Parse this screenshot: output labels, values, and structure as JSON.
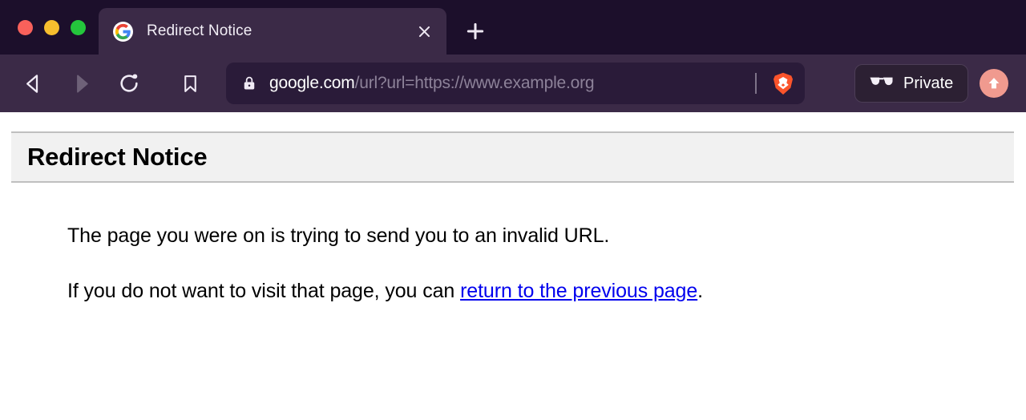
{
  "browser": {
    "name": "brave-browser",
    "window_controls": [
      {
        "name": "close",
        "color": "#F9615B"
      },
      {
        "name": "minimize",
        "color": "#F7BE2E"
      },
      {
        "name": "maximize",
        "color": "#24C63C"
      }
    ],
    "tab": {
      "title": "Redirect Notice",
      "favicon": "google-g-icon",
      "close_label": "×"
    },
    "new_tab_label": "+",
    "nav": {
      "back_label": "Back",
      "forward_label": "Forward",
      "reload_label": "Reload",
      "bookmark_label": "Bookmark"
    },
    "urlbar": {
      "lock": "secure-lock-icon",
      "host": "google.com",
      "path": "/url?url=https://www.example.org",
      "full_url": "google.com/url?url=https://www.example.org",
      "shields": "brave-lion-icon"
    },
    "private_button": {
      "label": "Private",
      "icon": "sunglasses-icon"
    },
    "profile_button": {
      "icon": "upload-arrow-icon",
      "color": "#F09A8F"
    },
    "colors": {
      "titlebar_bg": "#1C0F2B",
      "toolbar_bg": "#3B2A47",
      "tab_active_bg": "#3B2A47",
      "urlbar_bg": "#2A1B39",
      "url_host_text": "#FFFFFF",
      "url_path_text": "#8D8299",
      "brave_orange": "#FB542B"
    }
  },
  "page": {
    "heading": "Redirect Notice",
    "paragraph_1": "The page you were on is trying to send you to an invalid URL.",
    "paragraph_2_before": "If you do not want to visit that page, you can ",
    "paragraph_2_link": "return to the previous page",
    "paragraph_2_after": ".",
    "colors": {
      "header_bg": "#F1F1F1",
      "header_border": "#BFBFBF",
      "link": "#0000EE",
      "text": "#000000"
    }
  }
}
